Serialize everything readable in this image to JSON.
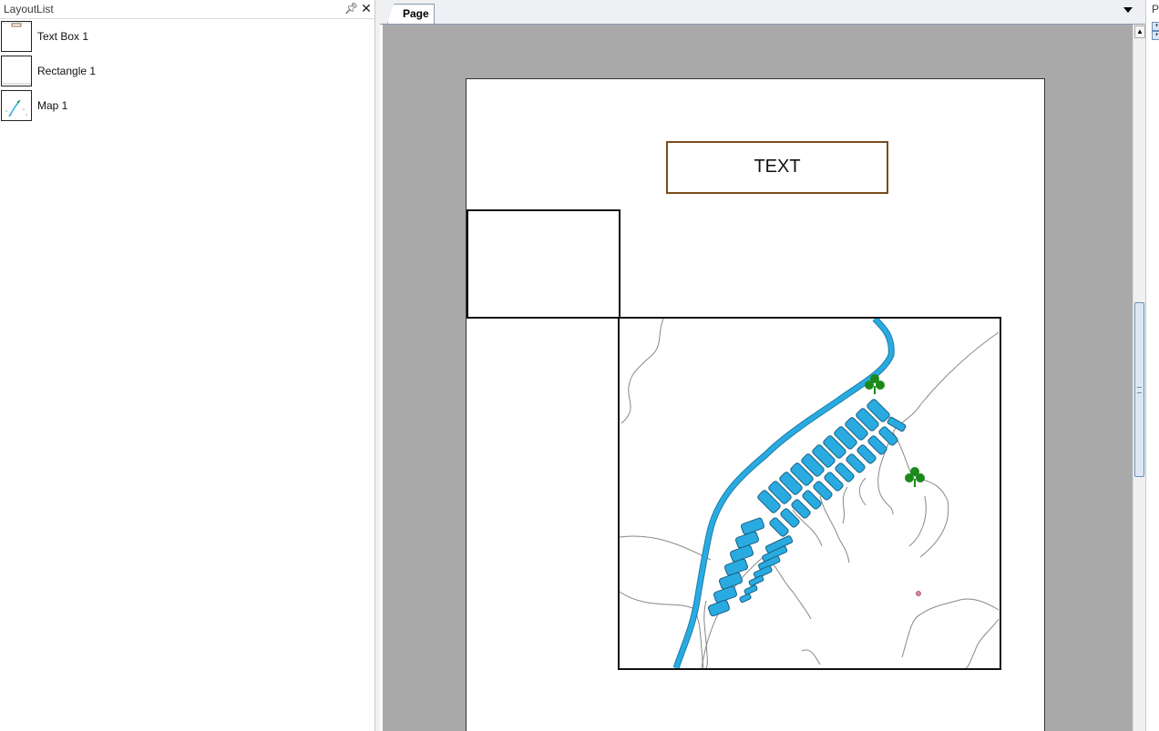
{
  "layout_list": {
    "title": "LayoutList",
    "items": [
      {
        "label": "Text Box 1",
        "icon": "text-box-thumbnail-icon"
      },
      {
        "label": "Rectangle 1",
        "icon": "rectangle-thumbnail-icon"
      },
      {
        "label": "Map 1",
        "icon": "map-thumbnail-icon"
      }
    ]
  },
  "document": {
    "tab_label": "Page",
    "text_box_text": "TEXT"
  },
  "right_panel": {
    "title": "P"
  },
  "colors": {
    "canvas_background": "#a9a9a9",
    "text_box_border": "#7a4b1e",
    "water": "#29abe2",
    "tree": "#1a8a1a"
  }
}
